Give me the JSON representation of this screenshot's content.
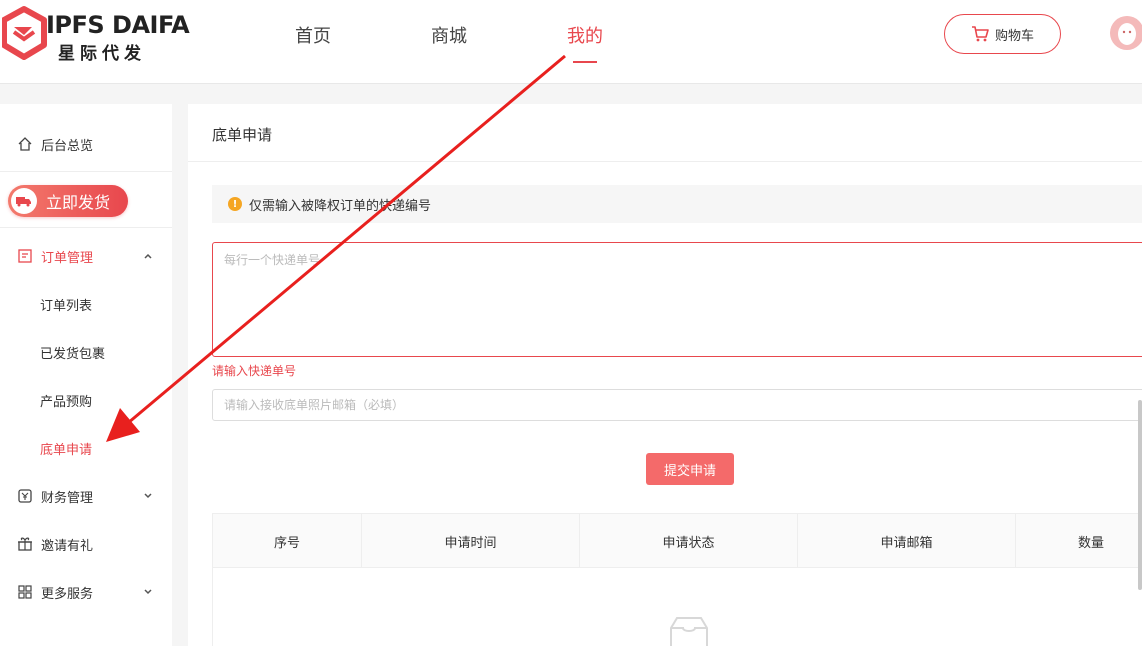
{
  "brand": {
    "name_en": "IPFS DAIFA",
    "name_cn": "星际代发",
    "color": "#e8474d"
  },
  "nav": {
    "items": [
      {
        "label": "首页"
      },
      {
        "label": "商城"
      },
      {
        "label": "我的",
        "active": true
      }
    ],
    "cart_label": "购物车"
  },
  "sidebar": {
    "overview": "后台总览",
    "ship_button": "立即发货",
    "order_mgmt": "订单管理",
    "order_sub": [
      "订单列表",
      "已发货包裹",
      "产品预购",
      "底单申请"
    ],
    "finance": "财务管理",
    "invite": "邀请有礼",
    "more": "更多服务"
  },
  "main": {
    "title": "底单申请",
    "notice": "仅需输入被降权订单的快递编号",
    "textarea_placeholder": "每行一个快递单号",
    "error": "请输入快递单号",
    "email_placeholder": "请输入接收底单照片邮箱（必填）",
    "submit": "提交申请",
    "table_headers": [
      "序号",
      "申请时间",
      "申请状态",
      "申请邮箱",
      "数量"
    ]
  }
}
